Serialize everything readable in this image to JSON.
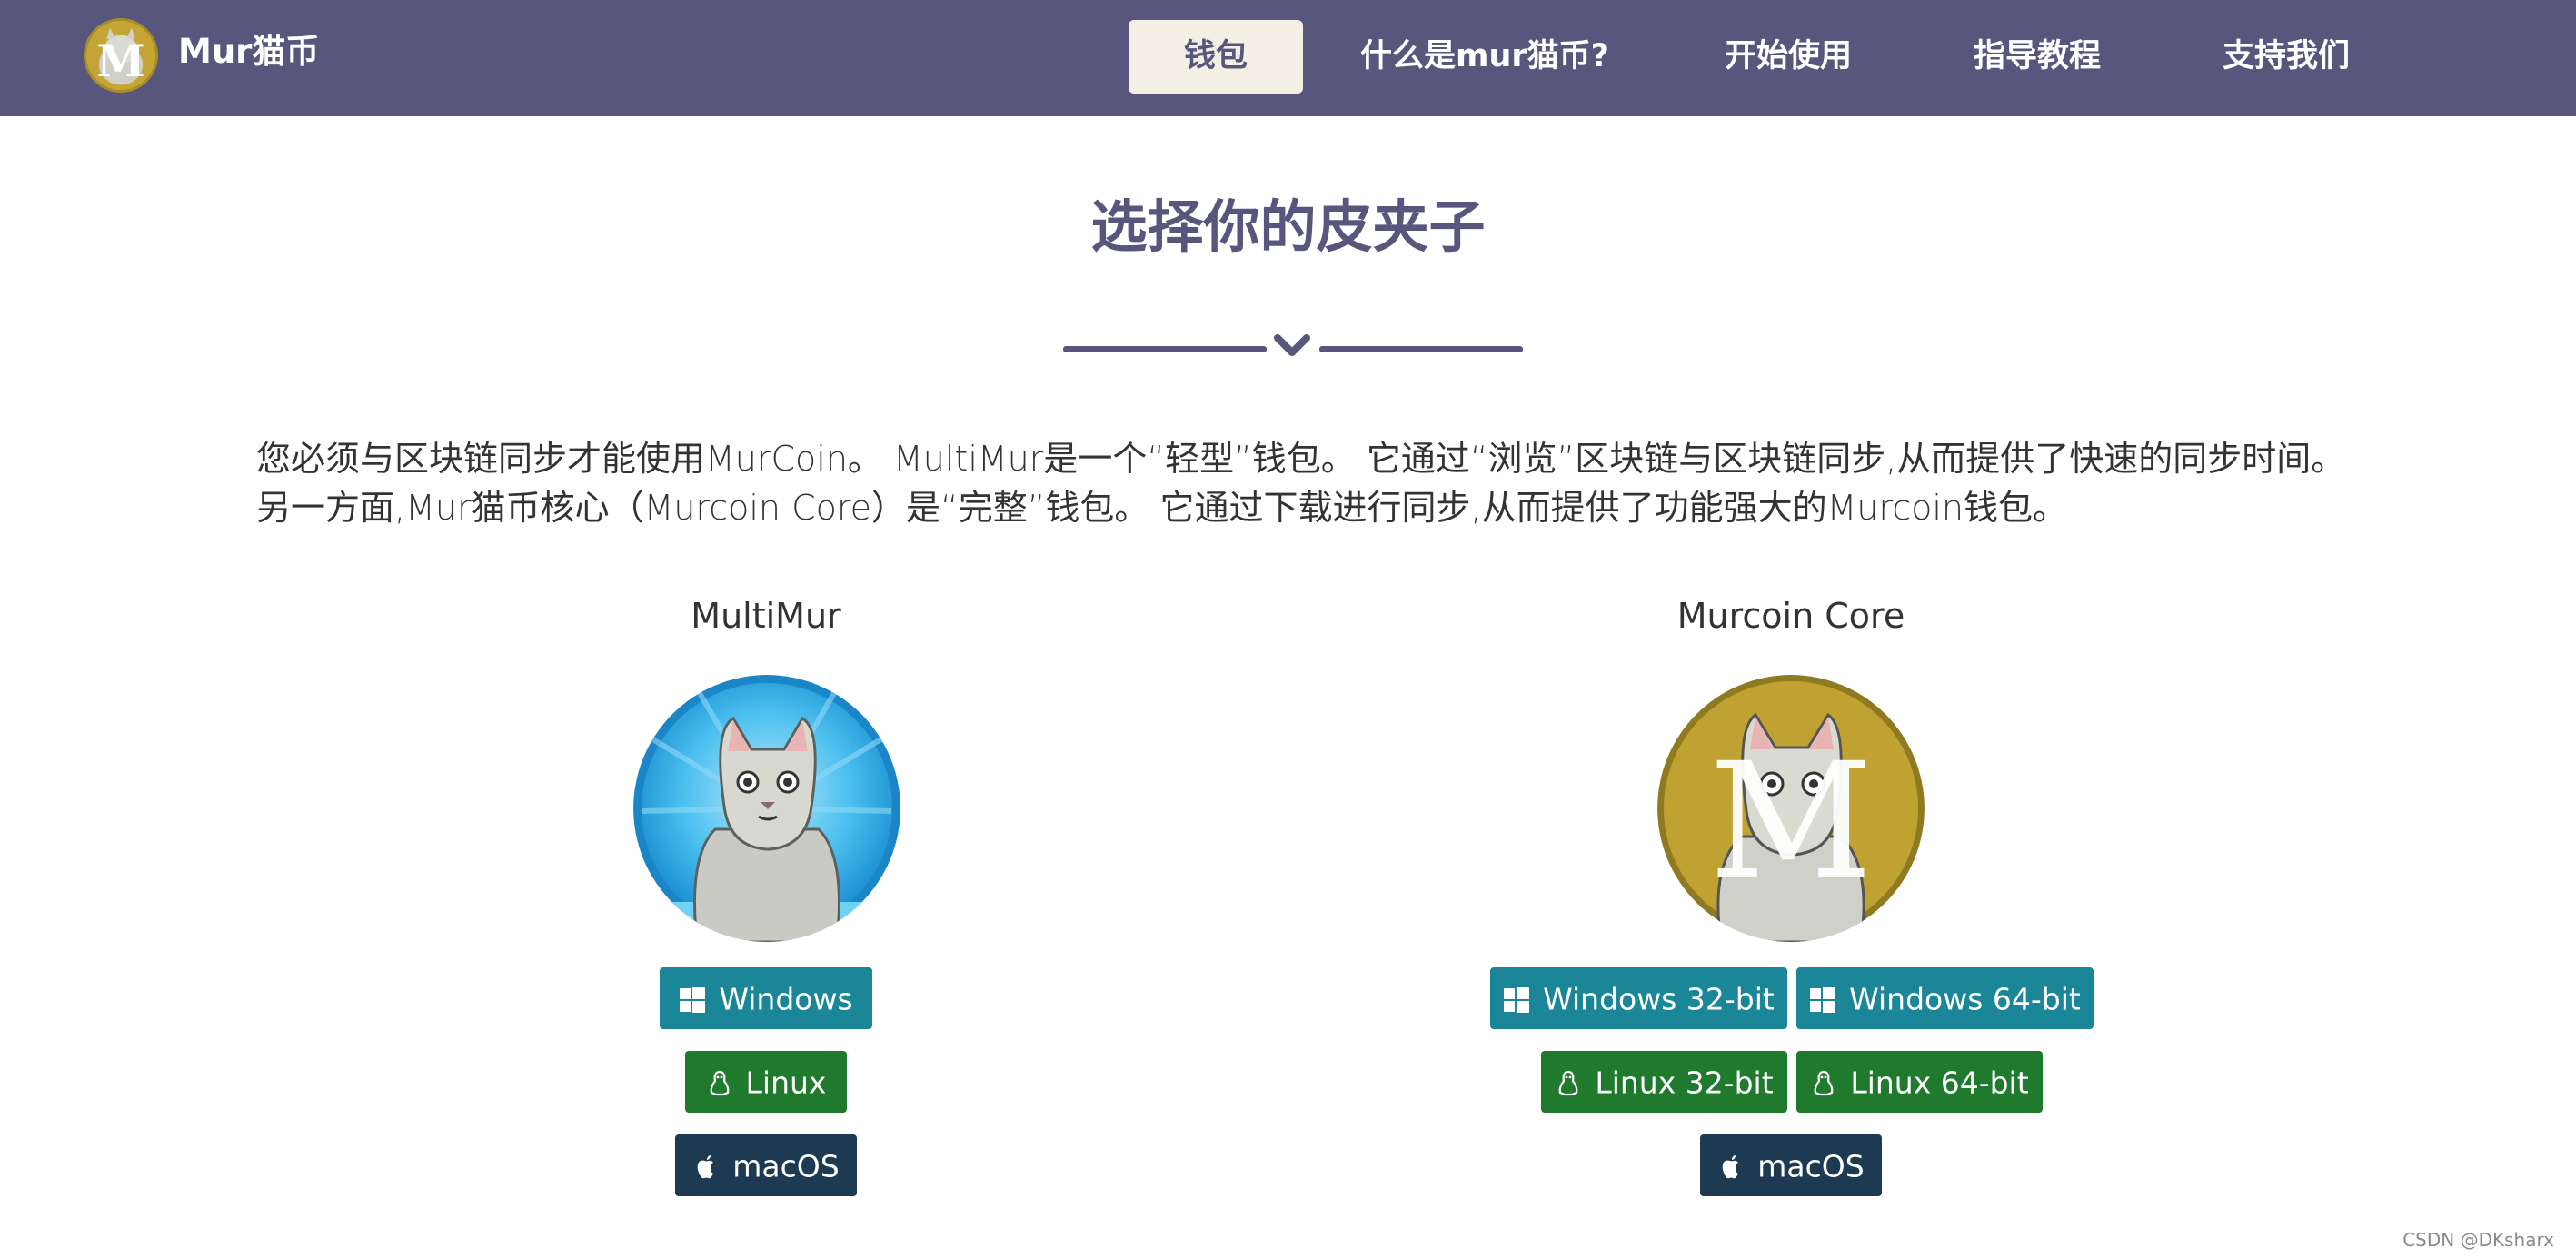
{
  "brand": {
    "name": "Mur猫币"
  },
  "nav": {
    "items": [
      "钱包",
      "什么是mur猫币?",
      "开始使用",
      "指导教程",
      "支持我们"
    ],
    "active": "钱包"
  },
  "page": {
    "heading": "选择你的皮夹子",
    "intro": "您必须与区块链同步才能使用MurCoin。 MultiMur是一个“轻型”钱包。 它通过“浏览”区块链与区块链同步,从而提供了快速的同步时间。 另一方面,Mur猫币核心（Murcoin Core）是“完整”钱包。 它通过下载进行同步,从而提供了功能强大的Murcoin钱包。"
  },
  "wallets": {
    "multimur": {
      "title": "MultiMur",
      "buttons": {
        "windows": "Windows",
        "linux": "Linux",
        "macos": "macOS"
      }
    },
    "core": {
      "title": "Murcoin Core",
      "buttons": {
        "windows32": "Windows 32-bit",
        "windows64": "Windows 64-bit",
        "linux32": "Linux 32-bit",
        "linux64": "Linux 64-bit",
        "macos": "macOS"
      }
    }
  },
  "watermark": "CSDN @DKsharx",
  "colors": {
    "navbar": "#58567d",
    "accent": "#58567d",
    "active_tab_bg": "#f4efe4",
    "windows_button": "#1a8697",
    "linux_button": "#1f7a2e",
    "mac_button": "#1e3a52",
    "coin_gold": "#c4a535",
    "multimur_blue": "#2aa8e0"
  },
  "icons": {
    "windows": "windows-icon",
    "linux": "linux-icon",
    "macos": "apple-icon",
    "divider": "chevron-down-icon"
  }
}
